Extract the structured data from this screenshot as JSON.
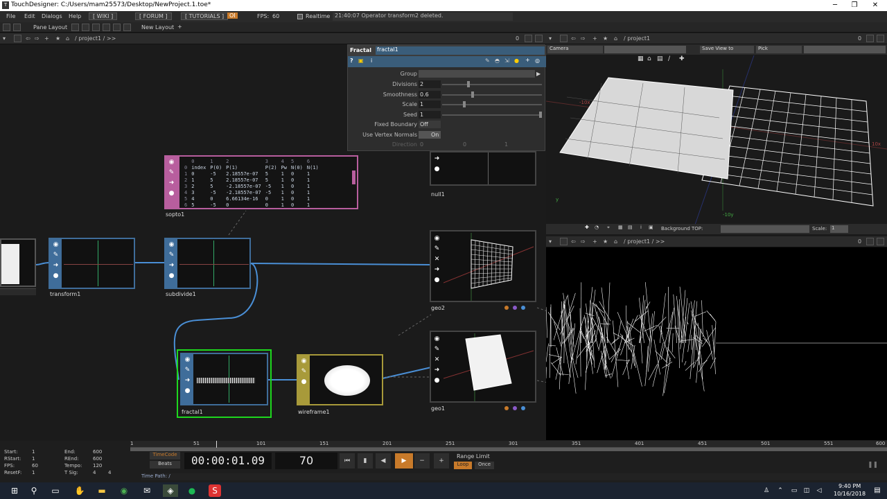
{
  "titlebar": {
    "title": "TouchDesigner: C:/Users/mam25573/Desktop/NewProject.1.toe*"
  },
  "menubar": {
    "items": [
      "File",
      "Edit",
      "Dialogs",
      "Help"
    ],
    "wiki": "[ WIKI ]",
    "forum": "[ FORUM ]",
    "tutorials": "[ TUTORIALS ]",
    "oi": "OI",
    "fps": "FPS:",
    "fps_value": "60",
    "realtime": "Realtime",
    "status": "21:40:07 Operator transform2 deleted."
  },
  "toolbar2": {
    "pane_layout": "Pane Layout",
    "new_layout": "New Layout",
    "new_layout_plus": "+"
  },
  "network_path": {
    "path": "/ project1 / >>",
    "zero": "0"
  },
  "param": {
    "op_type": "Fractal",
    "op_name": "fractal1",
    "rows": [
      {
        "label": "Group",
        "value": ""
      },
      {
        "label": "Divisions",
        "value": "2"
      },
      {
        "label": "Smoothness",
        "value": "0.6"
      },
      {
        "label": "Scale",
        "value": "1"
      },
      {
        "label": "Seed",
        "value": "1"
      },
      {
        "label": "Fixed Boundary",
        "value": "Off"
      },
      {
        "label": "Use Vertex Normals",
        "value": "On"
      },
      {
        "label": "Direction",
        "value": "0"
      }
    ],
    "direction_y": "0",
    "direction_z": "1"
  },
  "nodes": {
    "transform1": "transform1",
    "subdivide1": "subdivide1",
    "sopto1": "sopto1",
    "null1": "null1",
    "geo2": "geo2",
    "geo1": "geo1",
    "fractal1": "fractal1",
    "wireframe1": "wireframe1"
  },
  "sopto_table": {
    "col_numbers": [
      "0",
      "1",
      "2",
      "3",
      "4",
      "5",
      "6"
    ],
    "header": [
      "index",
      "P(0)",
      "P(1)",
      "P(2)",
      "Pw",
      "N(0)",
      "N(1)"
    ],
    "rows": [
      [
        "0",
        "-5",
        "2.18557e-07",
        "5",
        "1",
        "0",
        "1"
      ],
      [
        "1",
        "5",
        "2.18557e-07",
        "5",
        "1",
        "0",
        "1"
      ],
      [
        "2",
        "5",
        "-2.18557e-07",
        "-5",
        "1",
        "0",
        "1"
      ],
      [
        "3",
        "-5",
        "-2.18557e-07",
        "-5",
        "1",
        "0",
        "1"
      ],
      [
        "4",
        "0",
        "6.66134e-16",
        "0",
        "1",
        "0",
        "1"
      ],
      [
        "5",
        "-5",
        "0",
        "0",
        "1",
        "0",
        "1"
      ]
    ],
    "row_numbers": [
      "0",
      "1",
      "2",
      "3",
      "4",
      "5",
      "6"
    ]
  },
  "viewer1": {
    "path": "/ project1",
    "zero": "0",
    "camera": "Camera",
    "save_view": "Save View to",
    "pick": "Pick",
    "background_top": "Background TOP:",
    "scale_label": "Scale:",
    "scale_value": "1",
    "axis_labels": [
      "-10x",
      "10x",
      "-10y",
      "y"
    ]
  },
  "viewer2": {
    "path": "/ project1 / >>",
    "zero": "0"
  },
  "timebar": {
    "start_label": "Start:",
    "start": "1",
    "end_label": "End:",
    "end": "600",
    "rstart_label": "RStart:",
    "rstart": "1",
    "rend_label": "REnd:",
    "rend": "600",
    "fps_label": "FPS:",
    "fps": "60",
    "tempo_label": "Tempo:",
    "tempo": "120",
    "resetf_label": "ResetF:",
    "resetf": "1",
    "tsig_label": "T Sig:",
    "tsig1": "4",
    "tsig2": "4",
    "timecode": "TimeCode",
    "beats": "Beats",
    "time": "00:00:01.09",
    "frame": "70",
    "range_limit": "Range Limit",
    "loop": "Loop",
    "once": "Once",
    "time_path": "Time Path: /",
    "ruler": [
      "1",
      "51",
      "101",
      "151",
      "201",
      "251",
      "301",
      "351",
      "401",
      "451",
      "501",
      "551",
      "600"
    ]
  },
  "taskbar": {
    "time": "9:40 PM",
    "date": "10/16/2018"
  },
  "colors": {
    "accent_orange": "#c87a2a",
    "sop_blue": "#3f6d9a",
    "dat_pink": "#b85e9e",
    "mat_yellow": "#a89a3a",
    "selected_green": "#1ed81e"
  }
}
